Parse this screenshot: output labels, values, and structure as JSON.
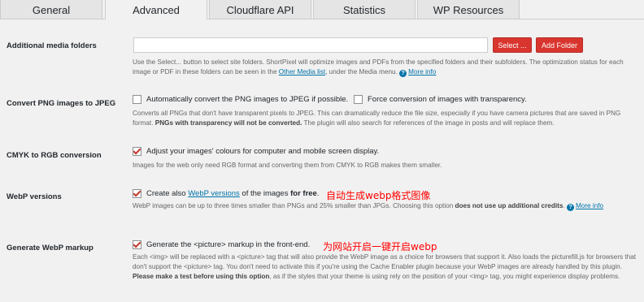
{
  "tabs": [
    "General",
    "Advanced",
    "Cloudflare API",
    "Statistics",
    "WP Resources"
  ],
  "media_folders": {
    "label": "Additional media folders",
    "select_button": "Select ...",
    "add_button": "Add Folder",
    "desc_before": "Use the Select... button to select site folders. ShortPixel will optimize images and PDFs from the specified folders and their subfolders. The optimization status for each image or PDF in these folders can be seen in the ",
    "desc_link": "Other Media list",
    "desc_after": ", under the Media menu.",
    "more_info": "More info"
  },
  "png_to_jpeg": {
    "label": "Convert PNG images to JPEG",
    "option1": "Automatically convert the PNG images to JPEG if possible.",
    "option2": "Force conversion of images with transparency.",
    "desc_before": "Converts all PNGs that don't have transparent pixels to JPEG. This can dramatically reduce the file size, especially if you have camera pictures that are saved in PNG format. ",
    "desc_bold": "PNGs with transparency will not be converted.",
    "desc_after": " The plugin will also search for references of the image in posts and will replace them."
  },
  "cmyk": {
    "label": "CMYK to RGB conversion",
    "option": "Adjust your images' colours for computer and mobile screen display.",
    "desc": "Images for the web only need RGB format and converting them from CMYK to RGB makes them smaller."
  },
  "webp": {
    "label": "WebP versions",
    "option_before": "Create also ",
    "option_link": "WebP versions",
    "option_middle": " of the images ",
    "option_bold": "for free",
    "option_after": ".",
    "annotation": "自动生成webp格式图像",
    "desc_before": "WebP images can be up to three times smaller than PNGs and 25% smaller than JPGs. Choosing this option ",
    "desc_bold": "does not use up additional credits",
    "desc_after": ".",
    "more_info": "More info"
  },
  "webp_markup": {
    "label": "Generate WebP markup",
    "option": "Generate the <picture> markup in the front-end.",
    "annotation": "为网站开启一键开启webp",
    "desc_before": "Each <img> will be replaced with a <picture> tag that will also provide the WebP image as a choice for browsers that support it. Also loads the picturefill.js for browsers that don't support the <picture> tag. You don't need to activate this if you're using the Cache Enabler plugin because your WebP images are already handled by this plugin. ",
    "desc_bold": "Please make a test before using this option",
    "desc_after": ", as if the styles that your theme is using rely on the position of your <img> tag, you might experience display problems."
  },
  "help_glyph": "?"
}
